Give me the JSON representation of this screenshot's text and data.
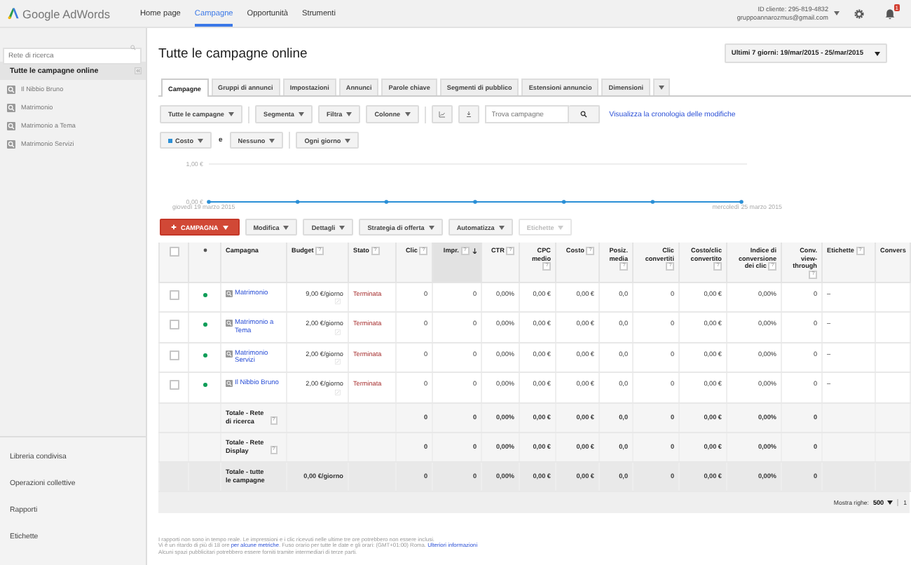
{
  "top_bar": {
    "logo": "Google AdWords",
    "nav": [
      {
        "label": "Home page",
        "selected": false
      },
      {
        "label": "Campagne",
        "selected": true
      },
      {
        "label": "Opportunità",
        "selected": false
      },
      {
        "label": "Strumenti",
        "selected": false
      }
    ],
    "customer_id": "ID cliente: 295-819-4832",
    "email": "gruppoannarozmus@gmail.com",
    "notification_count": "1"
  },
  "sidebar": {
    "search": {
      "placeholder": "Rete di ricerca"
    },
    "title": "Tutte le campagne online",
    "items": [
      {
        "label": "Il Nibbio Bruno"
      },
      {
        "label": "Matrimonio"
      },
      {
        "label": "Matrimonio a Tema"
      },
      {
        "label": "Matrimonio Servizi"
      }
    ],
    "links": [
      "Libreria condivisa",
      "Operazioni collettive",
      "Rapporti",
      "Etichette"
    ]
  },
  "page": {
    "title": "Tutte le campagne online",
    "date_range": "Ultimi 7 giorni: 19/mar/2015 - 25/mar/2015"
  },
  "tabs": [
    {
      "label": "Campagne",
      "selected": true
    },
    {
      "label": "Gruppi di annunci",
      "selected": false
    },
    {
      "label": "Impostazioni",
      "selected": false
    },
    {
      "label": "Annunci",
      "selected": false
    },
    {
      "label": "Parole chiave",
      "selected": false
    },
    {
      "label": "Segmenti di pubblico",
      "selected": false
    },
    {
      "label": "Estensioni annuncio",
      "selected": false
    },
    {
      "label": "Dimensioni",
      "selected": false
    }
  ],
  "toolbar": {
    "menus": [
      "Tutte le campagne",
      "Segmenta",
      "Filtra",
      "Colonne"
    ],
    "search": {
      "placeholder": "Trova campagne"
    },
    "history_link": "Visualizza la cronologia delle modifiche"
  },
  "chart_controls": {
    "joiner": "e",
    "second_metric": "Nessuno",
    "interval": "Ogni giorno"
  },
  "chart_data": {
    "type": "line",
    "categories": [
      "giovedì 19 marzo 2015",
      null,
      null,
      null,
      null,
      null,
      "mercoledì 25 marzo 2015"
    ],
    "ylim": [
      0,
      1
    ],
    "yticks": [
      {
        "value": 0,
        "label": "0,00 €"
      },
      {
        "value": 1,
        "label": "1,00 €"
      }
    ],
    "series": [
      {
        "name": "Costo",
        "color": "#2b8fd6",
        "values": [
          0,
          0,
          0,
          0,
          0,
          0,
          0
        ]
      }
    ]
  },
  "actions": [
    {
      "label": "CAMPAGNA",
      "kind": "primary",
      "disabled": false
    },
    {
      "label": "Modifica",
      "kind": "menu",
      "disabled": false
    },
    {
      "label": "Dettagli",
      "kind": "menu",
      "disabled": false
    },
    {
      "label": "Strategia di offerta",
      "kind": "menu",
      "disabled": false
    },
    {
      "label": "Automatizza",
      "kind": "menu",
      "disabled": false
    },
    {
      "label": "Etichette",
      "kind": "menu",
      "disabled": true
    }
  ],
  "table": {
    "select_all": {
      "checked": false
    },
    "columns": [
      {
        "label": "Campagna",
        "sorted": false
      },
      {
        "label": "Budget",
        "help": "?",
        "sorted": false
      },
      {
        "label": "Stato",
        "help": "?",
        "sorted": false
      },
      {
        "label": "Clic",
        "help": "?",
        "sorted": false
      },
      {
        "label": "Impr.",
        "help": "?",
        "sorted": true
      },
      {
        "label": "CTR",
        "help": "?",
        "sorted": false
      },
      {
        "label": "CPC medio",
        "help": "?",
        "sorted": false
      },
      {
        "label": "Costo",
        "help": "?",
        "sorted": false
      },
      {
        "label": "Posiz. media",
        "help": "?",
        "sorted": false
      },
      {
        "label": "Clic convertiti",
        "help": "?",
        "sorted": false
      },
      {
        "label": "Costo/clic convertito",
        "help": "?",
        "sorted": false
      },
      {
        "label": "Indice di conversione dei clic",
        "help": "?",
        "sorted": false
      },
      {
        "label": "Conv. view-through",
        "help": "?",
        "sorted": false
      },
      {
        "label": "Etichette",
        "help": "?",
        "sorted": false
      },
      {
        "label": "Convers",
        "sorted": false
      }
    ],
    "rows": [
      {
        "checked": false,
        "color": "#0f9d58",
        "name": "Matrimonio",
        "budget": "9,00 €/giorno",
        "status": "Terminata",
        "values": [
          "0",
          "0",
          "0,00%",
          "0,00 €",
          "0,00 €",
          "0,0",
          "0",
          "0,00 €",
          "0,00%",
          "0"
        ],
        "labels": "–"
      },
      {
        "checked": false,
        "color": "#0f9d58",
        "name": "Matrimonio a Tema",
        "budget": "2,00 €/giorno",
        "status": "Terminata",
        "values": [
          "0",
          "0",
          "0,00%",
          "0,00 €",
          "0,00 €",
          "0,0",
          "0",
          "0,00 €",
          "0,00%",
          "0"
        ],
        "labels": "–"
      },
      {
        "checked": false,
        "color": "#0f9d58",
        "name": "Matrimonio Servizi",
        "budget": "2,00 €/giorno",
        "status": "Terminata",
        "values": [
          "0",
          "0",
          "0,00%",
          "0,00 €",
          "0,00 €",
          "0,0",
          "0",
          "0,00 €",
          "0,00%",
          "0"
        ],
        "labels": "–"
      },
      {
        "checked": false,
        "color": "#0f9d58",
        "name": "Il Nibbio Bruno",
        "budget": "2,00 €/giorno",
        "status": "Terminata",
        "values": [
          "0",
          "0",
          "0,00%",
          "0,00 €",
          "0,00 €",
          "0,0",
          "0",
          "0,00 €",
          "0,00%",
          "0"
        ],
        "labels": "–"
      }
    ],
    "totals": [
      {
        "kind": "subtotal",
        "label": "Totale - Rete di ricerca",
        "help": "?",
        "values": [
          "0",
          "0",
          "0,00%",
          "0,00 €",
          "0,00 €",
          "0,0",
          "0",
          "0,00 €",
          "0,00%",
          "0"
        ]
      },
      {
        "kind": "subtotal",
        "label": "Totale - Rete Display",
        "help": "?",
        "values": [
          "0",
          "0",
          "0,00%",
          "0,00 €",
          "0,00 €",
          "0,0",
          "0",
          "0,00 €",
          "0,00%",
          "0"
        ]
      },
      {
        "kind": "grand_total",
        "label": "Totale - tutte le campagne",
        "budget": "0,00 €/giorno",
        "values": [
          "0",
          "0",
          "0,00%",
          "0,00 €",
          "0,00 €",
          "0,0",
          "0",
          "0,00 €",
          "0,00%",
          "0"
        ]
      }
    ]
  },
  "pagination": {
    "rows_label": "Mostra righe:",
    "rows_value": "500",
    "page": "1"
  },
  "notes": [
    [
      {
        "text": "I rapporti non sono in tempo reale. Le impressioni e i clic ricevuti nelle ultime tre ore potrebbero non essere inclusi.",
        "link": false
      }
    ],
    [
      {
        "text": "Vi è un ritardo di più di 18 ore ",
        "link": false
      },
      {
        "text": "per alcune metriche",
        "link": true
      },
      {
        "text": ". Fuso orario per tutte le date e gli orari: (GMT+01:00) Roma. ",
        "link": false
      },
      {
        "text": "Ulteriori informazioni",
        "link": true
      }
    ],
    [
      {
        "text": "Alcuni spazi pubblicitari potrebbero essere forniti tramite intermediari di terze parti.",
        "link": false
      }
    ]
  ]
}
